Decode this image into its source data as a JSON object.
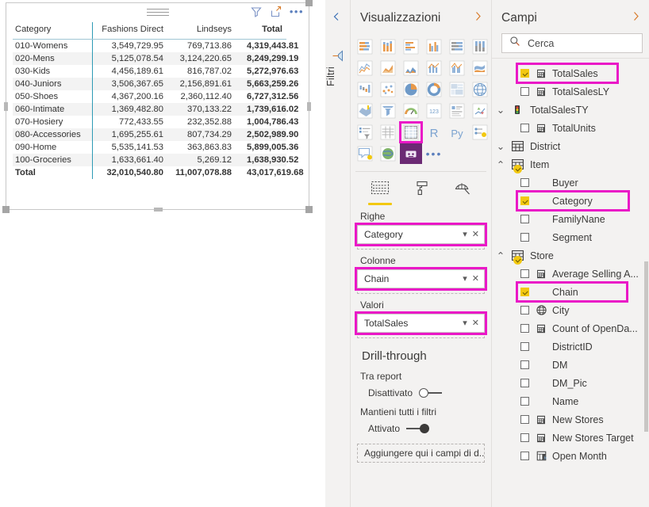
{
  "report": {
    "visual": {
      "name": "matrix-visual",
      "header_icons": [
        "filter-icon",
        "focus-mode-icon",
        "more-options-icon"
      ],
      "table": {
        "columns": [
          "Category",
          "Fashions Direct",
          "Lindseys",
          "Total"
        ],
        "rows": [
          {
            "category": "010-Womens",
            "fashions_direct": "3,549,729.95",
            "lindseys": "769,713.86",
            "total": "4,319,443.81"
          },
          {
            "category": "020-Mens",
            "fashions_direct": "5,125,078.54",
            "lindseys": "3,124,220.65",
            "total": "8,249,299.19"
          },
          {
            "category": "030-Kids",
            "fashions_direct": "4,456,189.61",
            "lindseys": "816,787.02",
            "total": "5,272,976.63"
          },
          {
            "category": "040-Juniors",
            "fashions_direct": "3,506,367.65",
            "lindseys": "2,156,891.61",
            "total": "5,663,259.26"
          },
          {
            "category": "050-Shoes",
            "fashions_direct": "4,367,200.16",
            "lindseys": "2,360,112.40",
            "total": "6,727,312.56"
          },
          {
            "category": "060-Intimate",
            "fashions_direct": "1,369,482.80",
            "lindseys": "370,133.22",
            "total": "1,739,616.02"
          },
          {
            "category": "070-Hosiery",
            "fashions_direct": "772,433.55",
            "lindseys": "232,352.88",
            "total": "1,004,786.43"
          },
          {
            "category": "080-Accessories",
            "fashions_direct": "1,695,255.61",
            "lindseys": "807,734.29",
            "total": "2,502,989.90"
          },
          {
            "category": "090-Home",
            "fashions_direct": "5,535,141.53",
            "lindseys": "363,863.83",
            "total": "5,899,005.36"
          },
          {
            "category": "100-Groceries",
            "fashions_direct": "1,633,661.40",
            "lindseys": "5,269.12",
            "total": "1,638,930.52"
          }
        ],
        "grand_total": {
          "category": "Total",
          "fashions_direct": "32,010,540.80",
          "lindseys": "11,007,078.88",
          "total": "43,017,619.68"
        }
      }
    }
  },
  "filters_rail": {
    "label": "Filtri",
    "collapse_icon": "chevron-left-icon",
    "filter_icon": "filter-icon"
  },
  "visualizations": {
    "title": "Visualizzazioni",
    "expand_icon": "chevron-right-icon",
    "gallery": [
      {
        "name": "stacked-bar-chart-icon"
      },
      {
        "name": "stacked-column-chart-icon"
      },
      {
        "name": "clustered-bar-chart-icon"
      },
      {
        "name": "clustered-column-chart-icon"
      },
      {
        "name": "100-percent-stacked-bar-chart-icon"
      },
      {
        "name": "100-percent-stacked-column-chart-icon"
      },
      {
        "name": "line-chart-icon"
      },
      {
        "name": "area-chart-icon"
      },
      {
        "name": "stacked-area-chart-icon"
      },
      {
        "name": "line-and-stacked-column-chart-icon"
      },
      {
        "name": "line-and-clustered-column-chart-icon"
      },
      {
        "name": "ribbon-chart-icon"
      },
      {
        "name": "waterfall-chart-icon"
      },
      {
        "name": "scatter-chart-icon"
      },
      {
        "name": "pie-chart-icon"
      },
      {
        "name": "donut-chart-icon"
      },
      {
        "name": "treemap-icon"
      },
      {
        "name": "map-icon"
      },
      {
        "name": "filled-map-icon"
      },
      {
        "name": "funnel-chart-icon"
      },
      {
        "name": "gauge-chart-icon"
      },
      {
        "name": "card-icon"
      },
      {
        "name": "multi-row-card-icon"
      },
      {
        "name": "kpi-icon"
      },
      {
        "name": "slicer-icon"
      },
      {
        "name": "table-icon"
      },
      {
        "name": "matrix-icon",
        "selected": true
      },
      {
        "name": "r-script-visual-icon"
      },
      {
        "name": "python-visual-icon"
      },
      {
        "name": "key-influencers-icon"
      },
      {
        "name": "qa-visual-icon"
      },
      {
        "name": "arcgis-maps-icon"
      },
      {
        "name": "custom-visual-icon"
      }
    ],
    "gallery_more": "•••",
    "well_tabs": [
      {
        "name": "fields-tab",
        "icon": "fields-pane-icon",
        "active": true
      },
      {
        "name": "format-tab",
        "icon": "paint-roller-icon",
        "active": false
      },
      {
        "name": "analytics-tab",
        "icon": "magnifier-chart-icon",
        "active": false
      }
    ],
    "wells": [
      {
        "label": "Righe",
        "field": "Category",
        "highlighted": true
      },
      {
        "label": "Colonne",
        "field": "Chain",
        "highlighted": true
      },
      {
        "label": "Valori",
        "field": "TotalSales",
        "highlighted": true
      }
    ],
    "drillthrough": {
      "title": "Drill-through",
      "cross_report_label": "Tra report",
      "cross_report_state": "Disattivato",
      "cross_report_on": false,
      "keep_filters_label": "Mantieni tutti i filtri",
      "keep_filters_state": "Attivato",
      "keep_filters_on": true,
      "dropzone": "Aggiungere qui i campi di d..."
    }
  },
  "fields": {
    "title": "Campi",
    "expand_icon": "chevron-right-icon",
    "search": {
      "placeholder": "Cerca",
      "value": "",
      "icon": "search-icon"
    },
    "items": [
      {
        "label": "TotalSales",
        "level": "child",
        "icon": "measure-icon",
        "checked": true,
        "highlight": "measure"
      },
      {
        "label": "TotalSalesLY",
        "level": "child",
        "icon": "measure-icon",
        "checked": false
      },
      {
        "label": "TotalSalesTY",
        "level": "group-kpi",
        "icon": "kpi-traffic-light-icon",
        "expander": "⌄"
      },
      {
        "label": "TotalUnits",
        "level": "child",
        "icon": "measure-icon",
        "checked": false
      },
      {
        "label": "District",
        "level": "table",
        "icon": "table-icon",
        "expander": "⌄"
      },
      {
        "label": "Item",
        "level": "table",
        "icon": "table-icon",
        "expander": "⌃",
        "badge": true
      },
      {
        "label": "Buyer",
        "level": "child",
        "icon": "none",
        "checked": false
      },
      {
        "label": "Category",
        "level": "child",
        "icon": "none",
        "checked": true,
        "highlight": "cat"
      },
      {
        "label": "FamilyNane",
        "level": "child",
        "icon": "none",
        "checked": false
      },
      {
        "label": "Segment",
        "level": "child",
        "icon": "none",
        "checked": false
      },
      {
        "label": "Store",
        "level": "table",
        "icon": "table-icon",
        "expander": "⌃",
        "badge": true
      },
      {
        "label": "Average Selling A...",
        "level": "child",
        "icon": "measure-icon",
        "checked": false
      },
      {
        "label": "Chain",
        "level": "child",
        "icon": "none",
        "checked": true,
        "highlight": "chain"
      },
      {
        "label": "City",
        "level": "child",
        "icon": "globe-icon",
        "checked": false
      },
      {
        "label": "Count of OpenDa...",
        "level": "child",
        "icon": "measure-icon",
        "checked": false
      },
      {
        "label": "DistrictID",
        "level": "child",
        "icon": "none",
        "checked": false
      },
      {
        "label": "DM",
        "level": "child",
        "icon": "none",
        "checked": false
      },
      {
        "label": "DM_Pic",
        "level": "child",
        "icon": "none",
        "checked": false
      },
      {
        "label": "Name",
        "level": "child",
        "icon": "none",
        "checked": false
      },
      {
        "label": "New Stores",
        "level": "child",
        "icon": "measure-icon",
        "checked": false
      },
      {
        "label": "New Stores Target",
        "level": "child",
        "icon": "measure-icon",
        "checked": false
      },
      {
        "label": "Open Month",
        "level": "child",
        "icon": "calculated-column-icon",
        "checked": false
      }
    ]
  },
  "colors": {
    "highlight": "#ea18c7",
    "accent_yellow": "#f2c811",
    "pane_bg": "#f3f2f1",
    "table_divider": "#2e9ab5"
  }
}
